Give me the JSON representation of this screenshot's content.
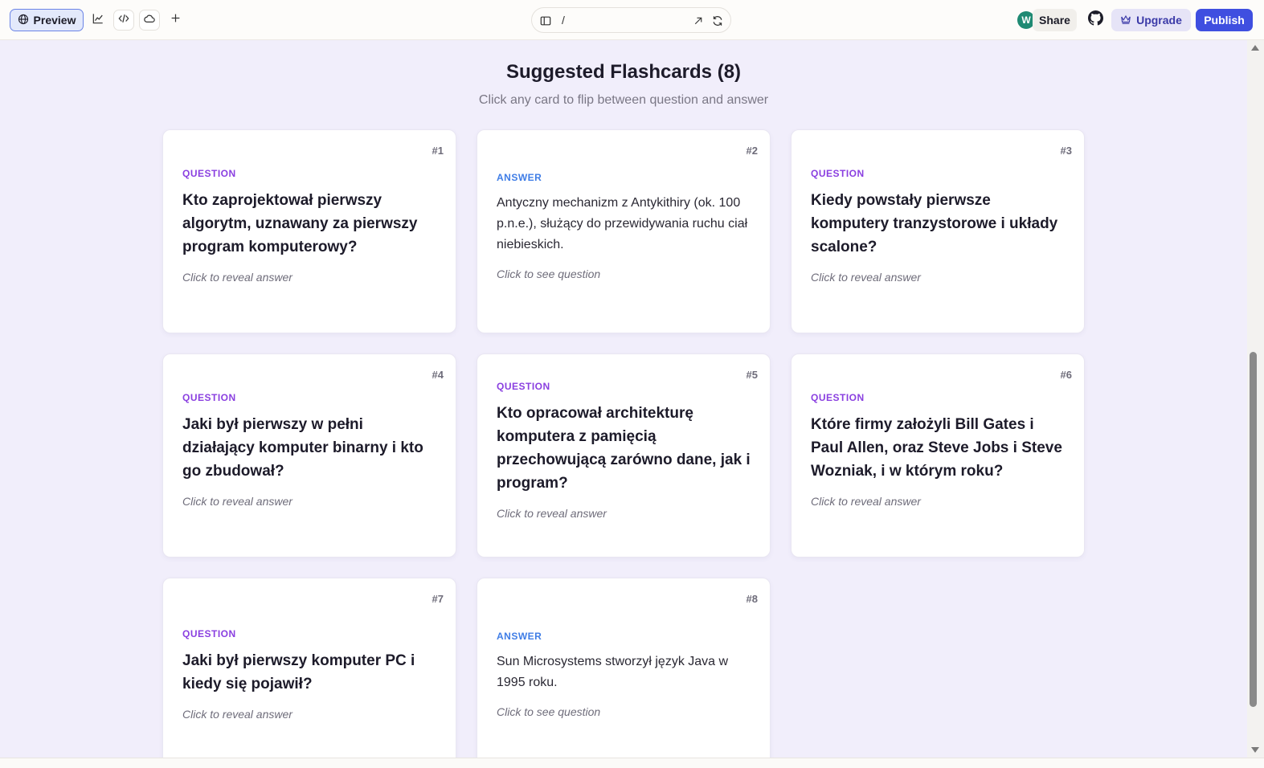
{
  "toolbar": {
    "preview_label": "Preview",
    "url_path": "/",
    "avatar_initial": "W",
    "share_label": "Share",
    "upgrade_label": "Upgrade",
    "publish_label": "Publish",
    "icons": [
      "globe-icon",
      "chart-icon",
      "code-icon",
      "cloud-icon",
      "plus-icon",
      "sidebar-panel-icon",
      "open-external-icon",
      "refresh-icon",
      "github-icon",
      "crown-icon"
    ]
  },
  "main": {
    "title": "Suggested Flashcards (8)",
    "subtitle": "Click any card to flip between question and answer",
    "cards": [
      {
        "num": "#1",
        "kind": "QUESTION",
        "text": "Kto zaprojektował pierwszy algorytm, uznawany za pierwszy program komputerowy?",
        "hint": "Click to reveal answer"
      },
      {
        "num": "#2",
        "kind": "ANSWER",
        "text": "Antyczny mechanizm z Antykithiry (ok. 100 p.n.e.), służący do przewidywania ruchu ciał niebieskich.",
        "hint": "Click to see question"
      },
      {
        "num": "#3",
        "kind": "QUESTION",
        "text": "Kiedy powstały pierwsze komputery tranzystorowe i układy scalone?",
        "hint": "Click to reveal answer"
      },
      {
        "num": "#4",
        "kind": "QUESTION",
        "text": "Jaki był pierwszy w pełni działający komputer binarny i kto go zbudował?",
        "hint": "Click to reveal answer"
      },
      {
        "num": "#5",
        "kind": "QUESTION",
        "text": "Kto opracował architekturę komputera z pamięcią przechowującą zarówno dane, jak i program?",
        "hint": "Click to reveal answer"
      },
      {
        "num": "#6",
        "kind": "QUESTION",
        "text": "Które firmy założyli Bill Gates i Paul Allen, oraz Steve Jobs i Steve Wozniak, i w którym roku?",
        "hint": "Click to reveal answer"
      },
      {
        "num": "#7",
        "kind": "QUESTION",
        "text": "Jaki był pierwszy komputer PC i kiedy się pojawił?",
        "hint": "Click to reveal answer"
      },
      {
        "num": "#8",
        "kind": "ANSWER",
        "text": "Sun Microsystems stworzył język Java w 1995 roku.",
        "hint": "Click to see question"
      }
    ]
  },
  "colors": {
    "accent": "#3f4fe0",
    "question_label": "#8a3fe0",
    "answer_label": "#3f7de6",
    "background": "#f1eefb"
  }
}
